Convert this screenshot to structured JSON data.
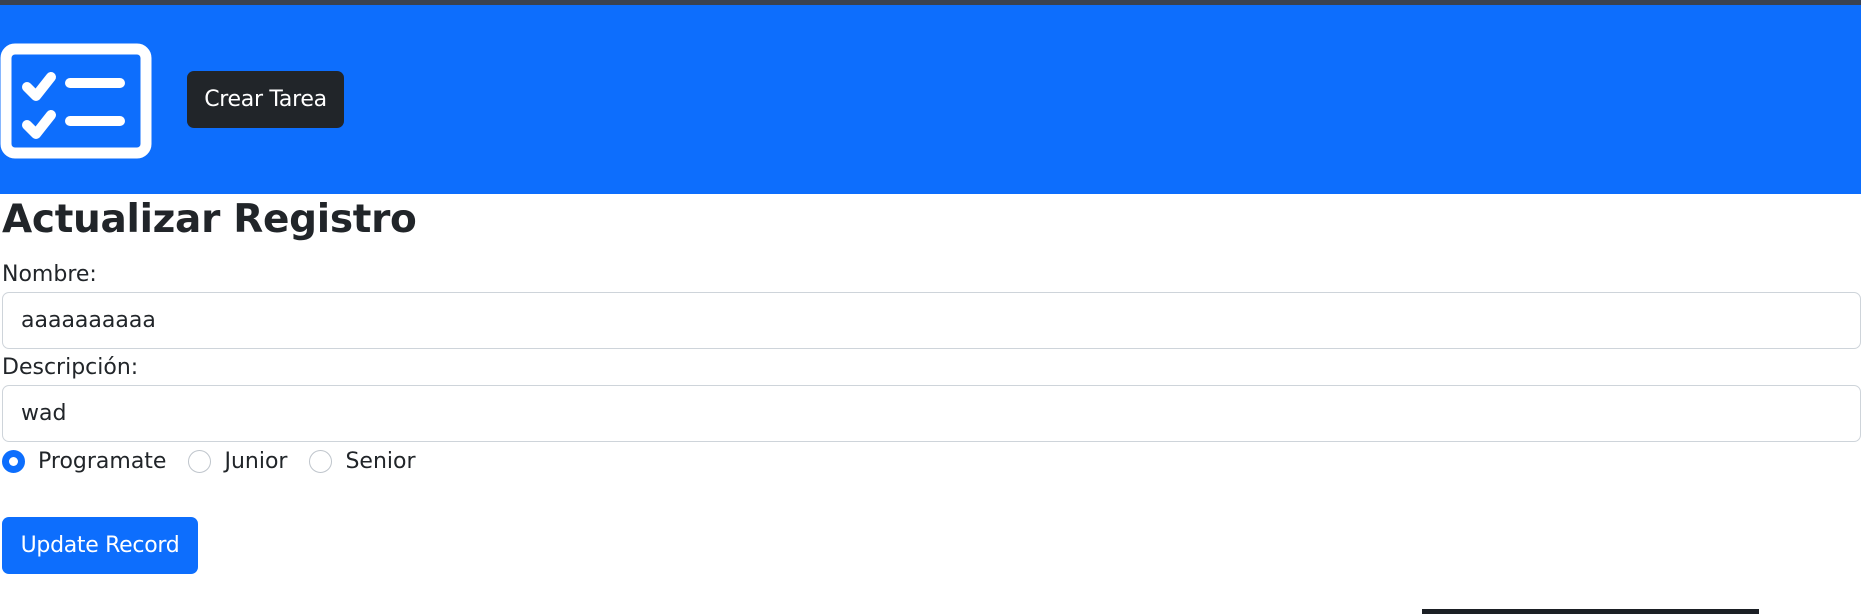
{
  "header": {
    "logo_icon": "task-list-icon",
    "create_task_label": "Crear Tarea",
    "background_color": "#0d6efd"
  },
  "form": {
    "title": "Actualizar Registro",
    "name_label": "Nombre:",
    "name_value": "aaaaaaaaaa",
    "description_label": "Descripción:",
    "description_value": "wad",
    "radio_options": [
      {
        "label": "Programate",
        "checked": true
      },
      {
        "label": "Junior",
        "checked": false
      },
      {
        "label": "Senior",
        "checked": false
      }
    ],
    "submit_label": "Update Record"
  },
  "colors": {
    "primary": "#0d6efd",
    "dark": "#212529"
  }
}
